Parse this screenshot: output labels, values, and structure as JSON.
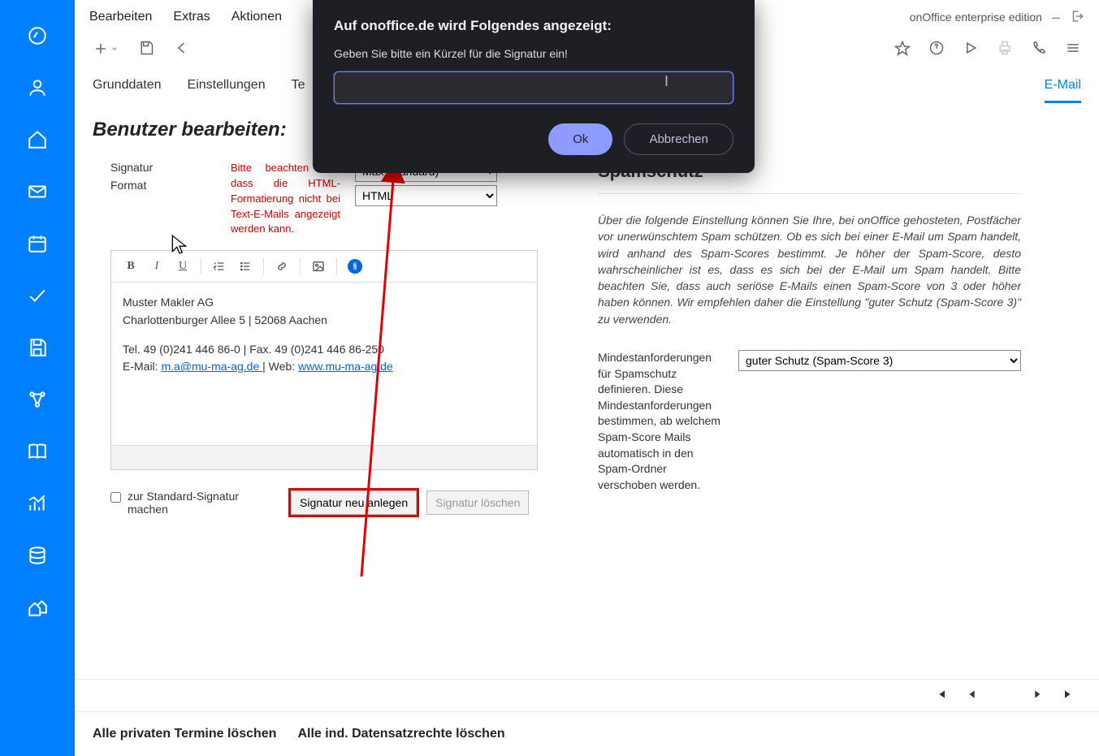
{
  "app": {
    "title": "onOffice enterprise edition"
  },
  "topmenu": {
    "edit": "Bearbeiten",
    "extras": "Extras",
    "actions": "Aktionen"
  },
  "tabs": {
    "t1": "Grunddaten",
    "t2": "Einstellungen",
    "t3": "Te",
    "active": "E-Mail"
  },
  "page_title": "Benutzer bearbeiten:",
  "form": {
    "signature_label": "Signatur",
    "format_label": "Format",
    "warn_text": "Bitte beachten Sie, dass die HTML-Formatierung nicht bei Text-E-Mails angezeigt werden kann.",
    "signature_select": "Max (standard)",
    "format_select": "HTML"
  },
  "editor_toolbar": {
    "b": "B",
    "i": "I",
    "u": "U"
  },
  "sig_body": {
    "line1": "Muster Makler  AG",
    "line2": "Charlottenburger Allee 5 | 52068 Aachen",
    "line3a": "Tel. 49 (0)241 446 86-0 | Fax. 49 (0)241 446 86-250",
    "line4a": "E-Mail: ",
    "email": "m.a@mu-ma-ag.de ",
    "line4b": "| Web: ",
    "web": "www.mu-ma-ag.de"
  },
  "actions": {
    "default_chk": "zur Standard-Signatur machen",
    "new_sig": "Signatur neu anlegen",
    "del_sig": "Signatur löschen"
  },
  "spam": {
    "heading": "Spamschutz",
    "para": "Über die folgende Einstellung können Sie Ihre, bei onOffice gehosteten, Postfächer vor unerwünschtem Spam schützen. Ob es sich bei einer E-Mail um Spam handelt, wird anhand des Spam-Scores bestimmt. Je höher der Spam-Score, desto wahrscheinlicher ist es, dass es sich bei der E-Mail um Spam handelt. Bitte beachten Sie, dass auch seriöse E-Mails einen Spam-Score von 3 oder höher haben können. Wir empfehlen daher die Einstellung \"guter Schutz (Spam-Score 3)\" zu verwenden.",
    "label": "Mindestanforderungen für Spamschutz definieren. Diese Mindestanforderungen bestimmen, ab welchem Spam-Score Mails automatisch in den Spam-Ordner verschoben werden.",
    "select": "guter Schutz (Spam-Score 3)"
  },
  "footer": {
    "a1": "Alle privaten Termine löschen",
    "a2": "Alle ind. Datensatzrechte löschen"
  },
  "modal": {
    "title": "Auf onoffice.de wird Folgendes angezeigt:",
    "prompt": "Geben Sie bitte ein Kürzel für die Signatur ein!",
    "value": "",
    "ok": "Ok",
    "cancel": "Abbrechen"
  }
}
